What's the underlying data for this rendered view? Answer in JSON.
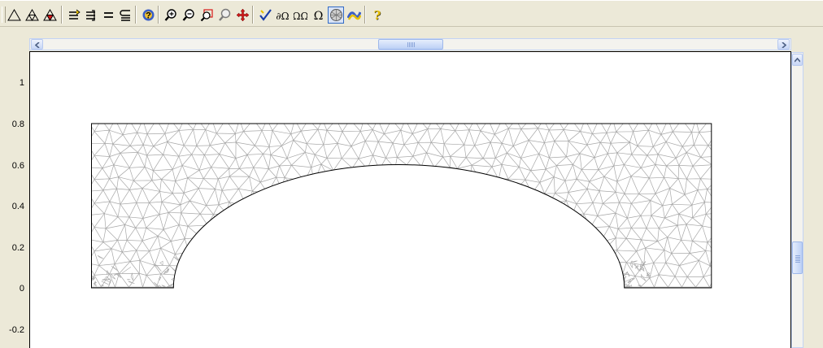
{
  "toolbar": {
    "buttons": [
      {
        "name": "triangle-icon-button",
        "icon": "triangle-icon",
        "pressed": false
      },
      {
        "name": "mesh-triangle-icon-button",
        "icon": "mesh-triangle-icon",
        "pressed": false
      },
      {
        "name": "refine-triangle-icon-button",
        "icon": "refine-triangle-icon",
        "pressed": false
      },
      {
        "name": "swap-rows-icon-button",
        "icon": "swap-rows-icon",
        "pressed": false
      },
      {
        "name": "split-rows-icon-button",
        "icon": "split-rows-icon",
        "pressed": false
      },
      {
        "name": "equals-icon-button",
        "icon": "equals-icon",
        "pressed": false
      },
      {
        "name": "subset-equals-icon-button",
        "icon": "subset-equals-icon",
        "pressed": false
      },
      {
        "name": "help-eye-icon-button",
        "icon": "help-eye-icon",
        "pressed": false
      },
      {
        "name": "zoom-in-icon-button",
        "icon": "zoom-in-icon",
        "pressed": false
      },
      {
        "name": "zoom-out-icon-button",
        "icon": "zoom-out-icon",
        "pressed": false
      },
      {
        "name": "zoom-window-icon-button",
        "icon": "zoom-window-icon",
        "pressed": false
      },
      {
        "name": "zoom-extents-icon-button",
        "icon": "zoom-extents-icon",
        "pressed": false
      },
      {
        "name": "pan-icon-button",
        "icon": "pan-icon",
        "pressed": false
      },
      {
        "name": "check-icon-button",
        "icon": "check-icon",
        "pressed": false
      },
      {
        "name": "delta-omega-icon-button",
        "icon": "delta-omega-icon",
        "pressed": false
      },
      {
        "name": "omega-omega-icon-button",
        "icon": "omega-omega-icon",
        "pressed": false
      },
      {
        "name": "omega-icon-button",
        "icon": "omega-icon",
        "pressed": false
      },
      {
        "name": "mesh-mode-icon-button",
        "icon": "mesh-mode-icon",
        "pressed": true
      },
      {
        "name": "plot-icon-button",
        "icon": "plot-icon",
        "pressed": false
      },
      {
        "name": "help-icon-button",
        "icon": "help-icon",
        "pressed": false
      }
    ]
  },
  "plot": {
    "y_ticks": [
      "1",
      "0.8",
      "0.6",
      "0.4",
      "0.2",
      "0",
      "-0.2"
    ]
  },
  "geometry": {
    "block": {
      "x_min": -3,
      "x_max": 3.05,
      "y_min": 0,
      "y_max": 0.8
    },
    "arch": {
      "center_x": 0,
      "y_base": 0,
      "half_width": 2.2,
      "height": 0.6
    }
  },
  "colors": {
    "mesh": "#a8a8a8",
    "boundary": "#000000",
    "selection": "#316ac5"
  }
}
